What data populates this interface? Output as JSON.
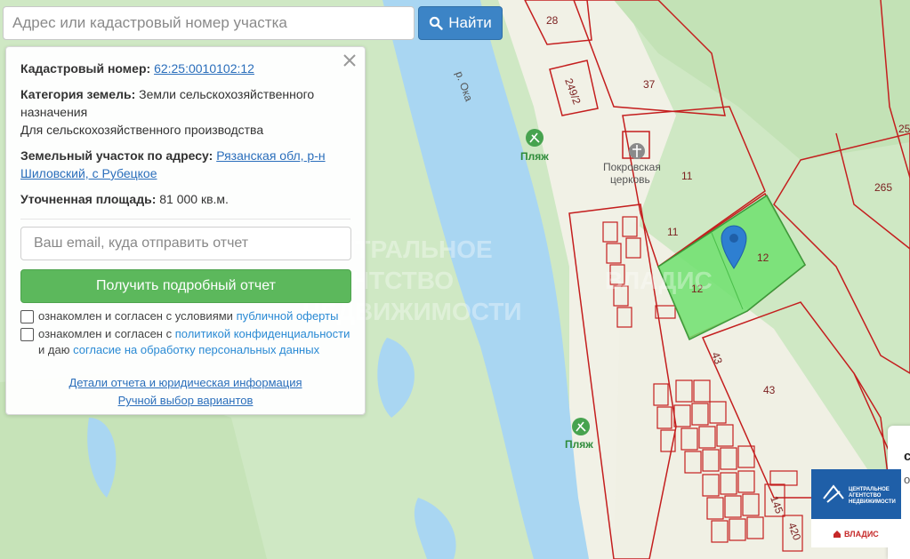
{
  "search": {
    "placeholder": "Адрес или кадастровый номер участка",
    "button_label": "Найти"
  },
  "panel": {
    "cadastral_label": "Кадастровый номер:",
    "cadastral_value": "62:25:0010102:12",
    "category_label": "Категория земель:",
    "category_value": "Земли сельскохозяйственного назначения",
    "usage": "Для сельскохозяйственного производства",
    "address_label": "Земельный участок по адресу:",
    "address_value": "Рязанская обл, р-н Шиловский, с Рубецкое",
    "area_label": "Уточненная площадь:",
    "area_value": "81 000 кв.м.",
    "email_placeholder": "Ваш email, куда отправить отчет",
    "get_report_label": "Получить подробный отчет",
    "check1_text": "ознакомлен и согласен с условиями",
    "check1_link": "публичной оферты",
    "check2_text": "ознакомлен и согласен с",
    "check2_link": "политикой конфиденциальности",
    "check2_text2": "и даю",
    "check2_link2": "согласие на обработку персональных данных",
    "details_link": "Детали отчета и юридическая информация",
    "manual_link": "Ручной выбор вариантов"
  },
  "map": {
    "river_name": "р. Ока",
    "beach_label": "Пляж",
    "church_line1": "Покровская",
    "church_line2": "церковь",
    "parcel_labels": [
      "28",
      "249/2",
      "37",
      "11",
      "11",
      "12",
      "12",
      "25",
      "265",
      "43",
      "43",
      "145",
      "420"
    ],
    "watermark_line1": "ЦЕНТРАЛЬНОЕ",
    "watermark_line2": "АГЕНТСТВО",
    "watermark_line3": "НЕДВИЖИМОСТИ",
    "watermark_brand": "ВЛАДИС",
    "selected_color": "#6fe06f",
    "river_color": "#a9d6f2",
    "parcel_border_color": "#c41e1e"
  },
  "logo": {
    "line1": "ЦЕНТРАЛЬНОЕ",
    "line2": "АГЕНТСТВО",
    "line3": "НЕДВИЖИМОСТИ",
    "brand": "ВЛАДИС"
  },
  "side_card": {
    "letter1": "с",
    "letter2": "о"
  }
}
